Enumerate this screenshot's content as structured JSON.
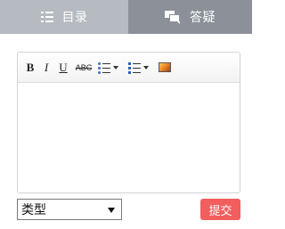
{
  "tabs": [
    {
      "label": "目录",
      "icon": "list-icon"
    },
    {
      "label": "答疑",
      "icon": "chat-icon"
    }
  ],
  "toolbar": {
    "bold": "B",
    "italic": "I",
    "underline": "U",
    "strikethrough": "ABC"
  },
  "form": {
    "type_select_value": "类型",
    "submit_label": "提交"
  },
  "colors": {
    "tab_active": "#b6bac1",
    "tab_inactive": "#8b9099",
    "submit": "#f25d5d"
  }
}
